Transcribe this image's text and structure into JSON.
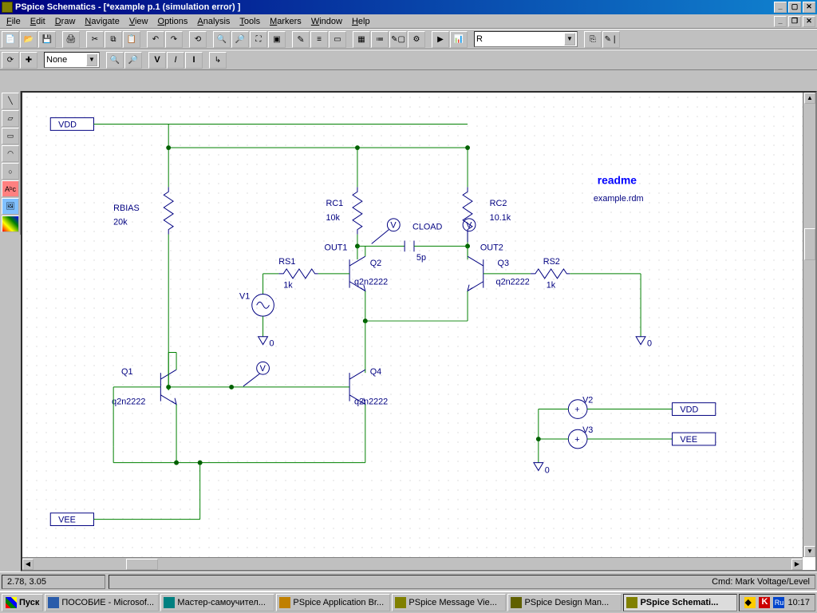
{
  "title": "PSpice Schematics - [*example  p.1  (simulation error) ]",
  "menus": [
    "File",
    "Edit",
    "Draw",
    "Navigate",
    "View",
    "Options",
    "Analysis",
    "Tools",
    "Markers",
    "Window",
    "Help"
  ],
  "toolbar1_combo": "R",
  "toolbar2_combo": "None",
  "canvas": {
    "readme_title": "readme",
    "readme_file": "example.rdm",
    "rails": {
      "vdd": "VDD",
      "vee": "VEE"
    },
    "labels": {
      "rbias": "RBIAS",
      "rbias_v": "20k",
      "rc1": "RC1",
      "rc1_v": "10k",
      "rc2": "RC2",
      "rc2_v": "10.1k",
      "rs1": "RS1",
      "rs1_v": "1k",
      "rs2": "RS2",
      "rs2_v": "1k",
      "v1": "V1",
      "q1": "Q1",
      "q2": "Q2",
      "q3": "Q3",
      "q4": "Q4",
      "model": "q2n2222",
      "out1": "OUT1",
      "out2": "OUT2",
      "cload": "CLOAD",
      "cload_v": "5p",
      "v2": "V2",
      "v3": "V3",
      "zero": "0"
    }
  },
  "status": {
    "coords": "2.78,  3.05",
    "cmd": "Cmd: Mark Voltage/Level"
  },
  "taskbar": {
    "start": "Пуск",
    "tasks": [
      {
        "label": "ПОСОБИЕ - Microsof...",
        "color": "#2a5caa"
      },
      {
        "label": "Мастер-самоучител...",
        "color": "#008080"
      },
      {
        "label": "PSpice Application Br...",
        "color": "#c08000"
      },
      {
        "label": "PSpice Message Vie...",
        "color": "#808000"
      },
      {
        "label": "PSpice Design Man...",
        "color": "#606000"
      },
      {
        "label": "PSpice Schemati...",
        "color": "#808000",
        "active": true
      }
    ],
    "lang": "Ru",
    "clock": "10:17"
  }
}
